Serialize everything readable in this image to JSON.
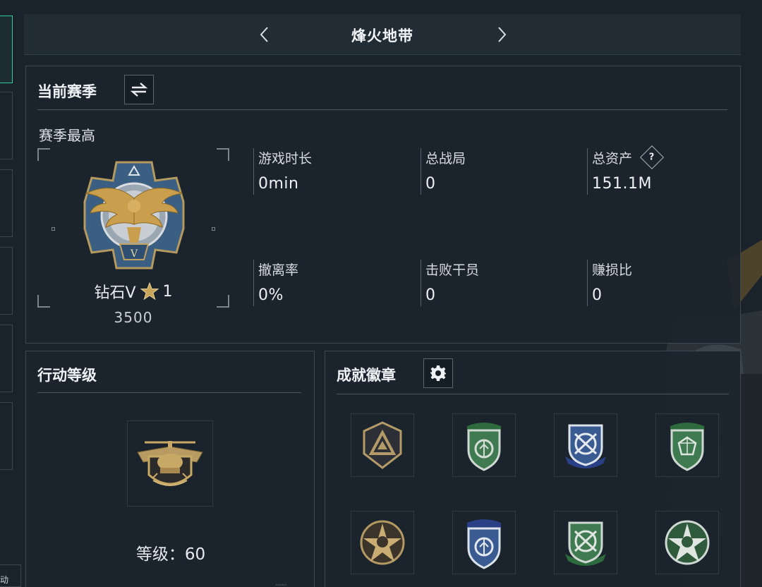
{
  "header": {
    "title": "烽火地带"
  },
  "left_strip": {
    "bottom_label": "动"
  },
  "season": {
    "title": "当前赛季",
    "subtitle": "赛季最高",
    "rank": {
      "name": "钻石V",
      "stars": "1",
      "score": "3500"
    },
    "stats": [
      {
        "label": "游戏时长",
        "value": "0min"
      },
      {
        "label": "总战局",
        "value": "0"
      },
      {
        "label": "总资产",
        "value": "151.1M",
        "help": "?"
      },
      {
        "label": "撤离率",
        "value": "0%"
      },
      {
        "label": "击败干员",
        "value": "0"
      },
      {
        "label": "赚损比",
        "value": "0"
      }
    ]
  },
  "level": {
    "title": "行动等级",
    "level_label": "等级：60"
  },
  "badges": {
    "title": "成就徽章",
    "items": [
      {
        "icon": "delta-triangle-badge-icon"
      },
      {
        "icon": "green-shield-badge-icon"
      },
      {
        "icon": "blue-arrows-badge-icon"
      },
      {
        "icon": "green-gem-badge-icon"
      },
      {
        "icon": "gold-skull-star-badge-icon"
      },
      {
        "icon": "blue-shield-badge-icon"
      },
      {
        "icon": "green-arrows-badge-icon"
      },
      {
        "icon": "green-skull-star-badge-icon"
      }
    ]
  },
  "colors": {
    "accent": "#2fcf9a",
    "panel": "#1b242c",
    "border": "#3c4852"
  }
}
